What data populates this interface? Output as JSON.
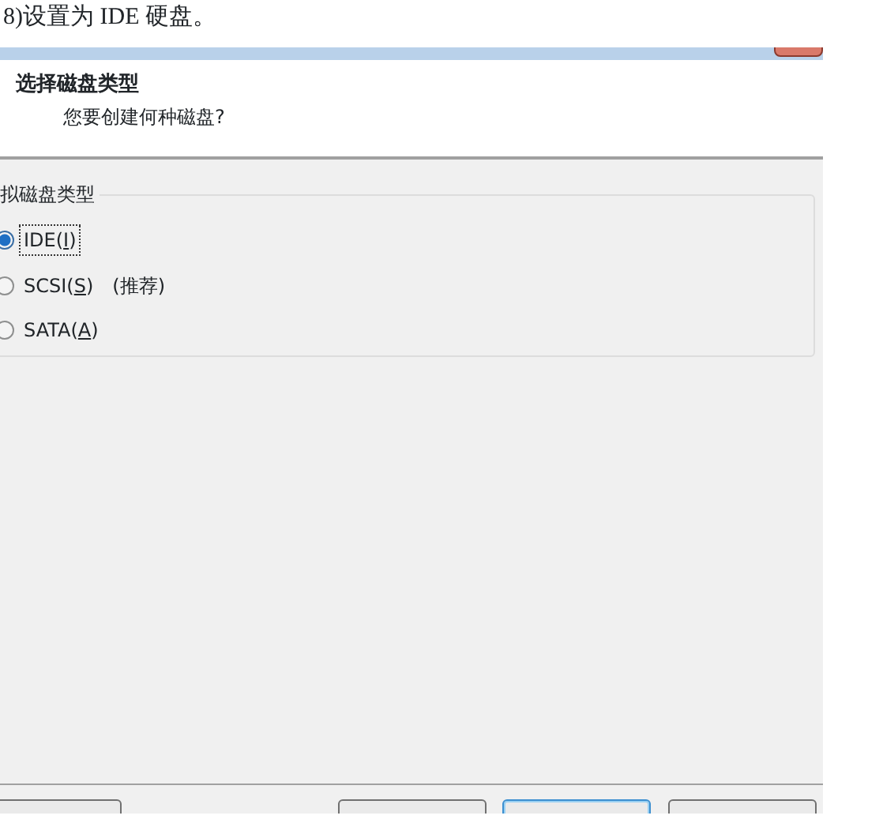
{
  "caption": "8)设置为 IDE 硬盘。",
  "dialog": {
    "heading": "选择磁盘类型",
    "subheading": "您要创建何种磁盘?",
    "group": {
      "label": "拟磁盘类型",
      "options": [
        {
          "label": "IDE(**I**)",
          "selected": true
        },
        {
          "label": "SCSI(**S**)",
          "note": "(推荐)",
          "selected": false
        },
        {
          "label": "SATA(**A**)",
          "selected": false
        }
      ]
    },
    "buttons": [
      {
        "kind": "plain"
      },
      {
        "kind": "plain"
      },
      {
        "kind": "default"
      },
      {
        "kind": "plain"
      }
    ]
  }
}
